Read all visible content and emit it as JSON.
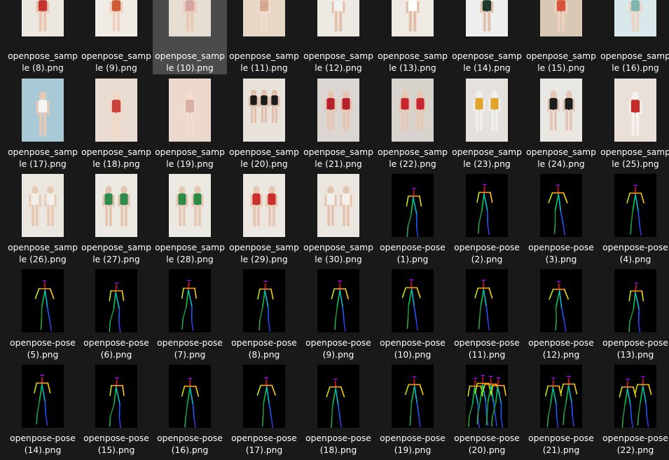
{
  "window": {
    "view": "Large icons"
  },
  "items": [
    {
      "name": "openpose_sample (8).png",
      "kind": "photo",
      "palette": [
        "#ece7df",
        "#c8342f",
        "#e8c6b2"
      ],
      "selected": false
    },
    {
      "name": "openpose_sample (9).png",
      "kind": "photo",
      "palette": [
        "#f0ebe4",
        "#cf5a36",
        "#efd3c1"
      ],
      "selected": false
    },
    {
      "name": "openpose_sample (10).png",
      "kind": "photo",
      "palette": [
        "#e6ded3",
        "#d6a7a2",
        "#eac9b6"
      ],
      "selected": true
    },
    {
      "name": "openpose_sample (11).png",
      "kind": "photo",
      "palette": [
        "#e7d7c7",
        "#d7a890",
        "#f0dccb"
      ],
      "selected": false
    },
    {
      "name": "openpose_sample (12).png",
      "kind": "photo",
      "palette": [
        "#ede9e3",
        "#f2f2f0",
        "#e4c1ac"
      ],
      "selected": false
    },
    {
      "name": "openpose_sample (13).png",
      "kind": "photo",
      "palette": [
        "#efeae4",
        "#ffffff",
        "#e2bea8"
      ],
      "selected": false
    },
    {
      "name": "openpose_sample (14).png",
      "kind": "photo",
      "palette": [
        "#efefef",
        "#1f3a2d",
        "#e2c2ae"
      ],
      "selected": false
    },
    {
      "name": "openpose_sample (15).png",
      "kind": "photo",
      "palette": [
        "#d8c8b4",
        "#d7543a",
        "#edd0bd"
      ],
      "selected": false
    },
    {
      "name": "openpose_sample (16).png",
      "kind": "photo",
      "palette": [
        "#d9e8ea",
        "#7fb7b0",
        "#efd3c2"
      ],
      "selected": false
    },
    {
      "name": "openpose_sample (17).png",
      "kind": "photo",
      "palette": [
        "#a9c9d7",
        "#f4f4f4",
        "#e7c8b3"
      ],
      "selected": false
    },
    {
      "name": "openpose_sample (18).png",
      "kind": "photo",
      "palette": [
        "#e9dcd1",
        "#c9433b",
        "#f0d7c6"
      ],
      "selected": false
    },
    {
      "name": "openpose_sample (19).png",
      "kind": "photo",
      "palette": [
        "#ecd8cd",
        "#d9b1a4",
        "#f1dccd"
      ],
      "selected": false
    },
    {
      "name": "openpose_sample (20).png",
      "kind": "photo",
      "palette": [
        "#e8e2da",
        "#1b1b1b",
        "#e0c0ab"
      ],
      "selected": false
    },
    {
      "name": "openpose_sample (21).png",
      "kind": "photo",
      "palette": [
        "#dcd6d2",
        "#b3212b",
        "#e6c4b0"
      ],
      "selected": false
    },
    {
      "name": "openpose_sample (22).png",
      "kind": "photo",
      "palette": [
        "#d9d3cd",
        "#c7262f",
        "#e7c8b5"
      ],
      "selected": false
    },
    {
      "name": "openpose_sample (23).png",
      "kind": "photo",
      "palette": [
        "#e5e2dd",
        "#e2a42a",
        "#f0f0ee"
      ],
      "selected": false
    },
    {
      "name": "openpose_sample (24).png",
      "kind": "photo",
      "palette": [
        "#e9e7e3",
        "#1e1e1e",
        "#e3c6b3"
      ],
      "selected": false
    },
    {
      "name": "openpose_sample (25).png",
      "kind": "photo",
      "palette": [
        "#e9e0d9",
        "#c72b2b",
        "#f4f1ee"
      ],
      "selected": false
    },
    {
      "name": "openpose_sample (26).png",
      "kind": "photo",
      "palette": [
        "#ebe6df",
        "#f2eee8",
        "#e7c9b4"
      ],
      "selected": false
    },
    {
      "name": "openpose_sample (27).png",
      "kind": "photo",
      "palette": [
        "#ece8e2",
        "#2f8a4b",
        "#e4c4ae"
      ],
      "selected": false
    },
    {
      "name": "openpose_sample (28).png",
      "kind": "photo",
      "palette": [
        "#ece8e2",
        "#2d8b45",
        "#e6c8b2"
      ],
      "selected": false
    },
    {
      "name": "openpose_sample (29).png",
      "kind": "photo",
      "palette": [
        "#ece7e1",
        "#c9302c",
        "#e7c6b1"
      ],
      "selected": false
    },
    {
      "name": "openpose_sample (30).png",
      "kind": "photo",
      "palette": [
        "#ebe6e0",
        "#f3efe9",
        "#e4c4ae"
      ],
      "selected": false
    },
    {
      "name": "openpose-pose (1).png",
      "kind": "pose",
      "variant": 1,
      "selected": false
    },
    {
      "name": "openpose-pose (2).png",
      "kind": "pose",
      "variant": 2,
      "selected": false
    },
    {
      "name": "openpose-pose (3).png",
      "kind": "pose",
      "variant": 3,
      "selected": false
    },
    {
      "name": "openpose-pose (4).png",
      "kind": "pose",
      "variant": 4,
      "selected": false
    },
    {
      "name": "openpose-pose (5).png",
      "kind": "pose",
      "variant": 5,
      "selected": false
    },
    {
      "name": "openpose-pose (6).png",
      "kind": "pose",
      "variant": 6,
      "selected": false
    },
    {
      "name": "openpose-pose (7).png",
      "kind": "pose",
      "variant": 7,
      "selected": false
    },
    {
      "name": "openpose-pose (8).png",
      "kind": "pose",
      "variant": 8,
      "selected": false
    },
    {
      "name": "openpose-pose (9).png",
      "kind": "pose",
      "variant": 9,
      "selected": false
    },
    {
      "name": "openpose-pose (10).png",
      "kind": "pose",
      "variant": 10,
      "selected": false
    },
    {
      "name": "openpose-pose (11).png",
      "kind": "pose",
      "variant": 11,
      "selected": false
    },
    {
      "name": "openpose-pose (12).png",
      "kind": "pose",
      "variant": 12,
      "selected": false
    },
    {
      "name": "openpose-pose (13).png",
      "kind": "pose",
      "variant": 13,
      "selected": false
    },
    {
      "name": "openpose-pose (14).png",
      "kind": "pose",
      "variant": 14,
      "selected": false
    },
    {
      "name": "openpose-pose (15).png",
      "kind": "pose",
      "variant": 15,
      "selected": false
    },
    {
      "name": "openpose-pose (16).png",
      "kind": "pose",
      "variant": 16,
      "selected": false
    },
    {
      "name": "openpose-pose (17).png",
      "kind": "pose",
      "variant": 17,
      "selected": false
    },
    {
      "name": "openpose-pose (18).png",
      "kind": "pose",
      "variant": 18,
      "selected": false
    },
    {
      "name": "openpose-pose (19).png",
      "kind": "pose",
      "variant": 19,
      "selected": false
    },
    {
      "name": "openpose-pose (20).png",
      "kind": "pose",
      "variant": 20,
      "selected": false
    },
    {
      "name": "openpose-pose (21).png",
      "kind": "pose",
      "variant": 21,
      "selected": false
    },
    {
      "name": "openpose-pose (22).png",
      "kind": "pose",
      "variant": 22,
      "selected": false
    }
  ]
}
